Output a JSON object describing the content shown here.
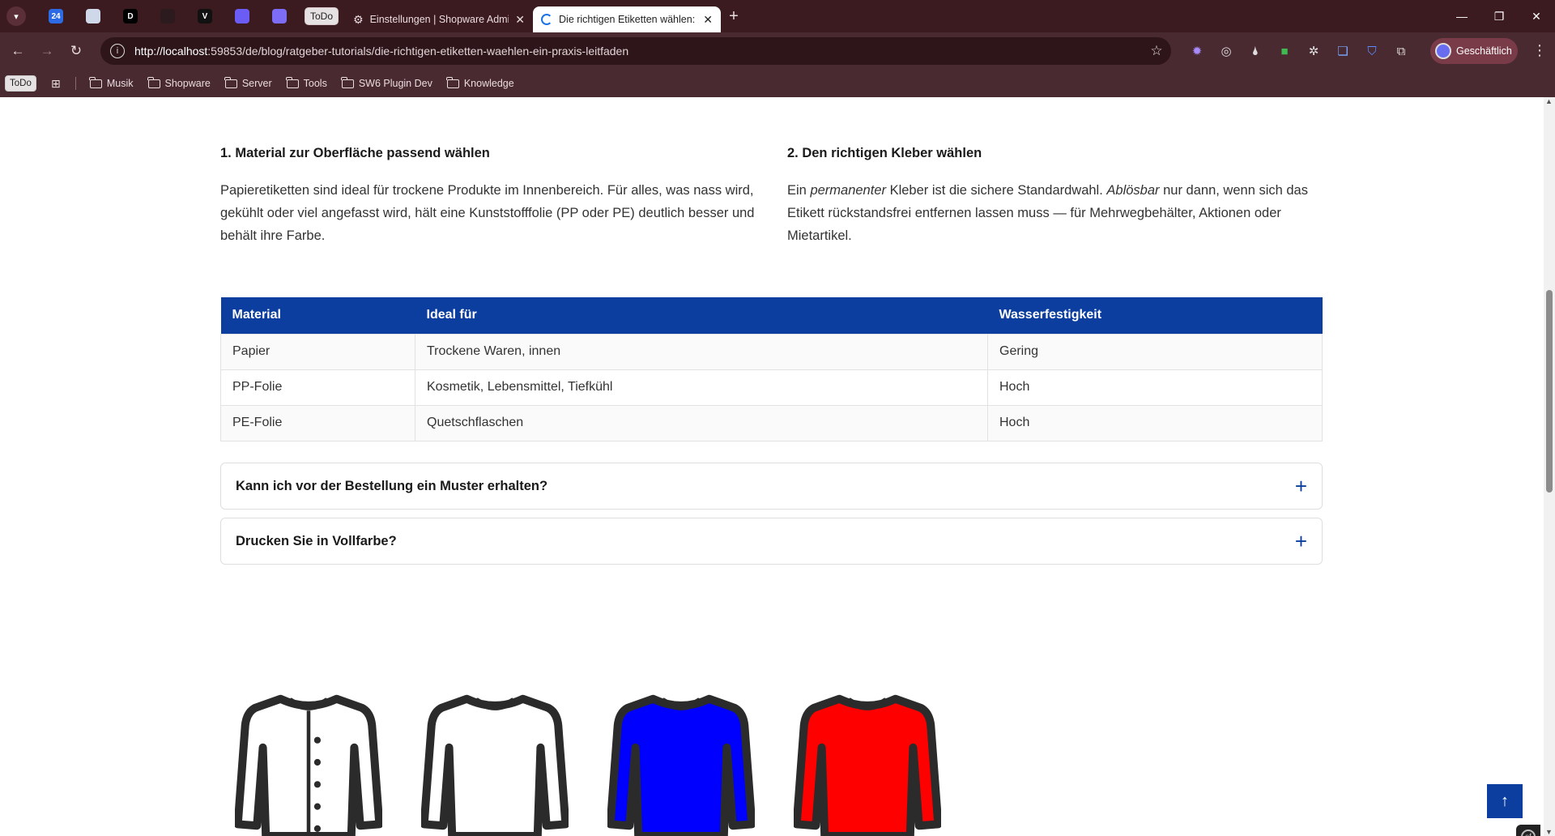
{
  "browser": {
    "pinned_tabs": [
      {
        "icon": "calendar-24-icon",
        "label": "24",
        "color": "#2d6be4"
      },
      {
        "icon": "cube-icon",
        "label": "",
        "color": "#cfd8e8"
      },
      {
        "icon": "d-logo-icon",
        "label": "D",
        "color": "#000000"
      },
      {
        "icon": "github-icon",
        "label": "",
        "color": "#2b1b1e"
      },
      {
        "icon": "v-logo-icon",
        "label": "V",
        "color": "#111111"
      },
      {
        "icon": "proton-icon",
        "label": "",
        "color": "#6b5cf5"
      },
      {
        "icon": "orb-icon",
        "label": "",
        "color": "#7d6cf6"
      }
    ],
    "todo_tab": "ToDo",
    "tabs": [
      {
        "title": "Einstellungen | Shopware Admin",
        "active": false
      },
      {
        "title": "Die richtigen Etiketten wählen: Ein Praxis-Leitfaden",
        "active": true
      }
    ],
    "url_host": "http://localhost",
    "url_rest": ":59853/de/blog/ratgeber-tutorials/die-richtigen-etiketten-waehlen-ein-praxis-leitfaden",
    "profile_label": "Geschäftlich",
    "bookmarks_todo": "ToDo",
    "bookmarks": [
      "Musik",
      "Shopware",
      "Server",
      "Tools",
      "SW6 Plugin Dev",
      "Knowledge"
    ]
  },
  "article": {
    "left": {
      "heading": "1. Material zur Oberfläche passend wählen",
      "text": "Papieretiketten sind ideal für trockene Produkte im Innenbereich. Für alles, was nass wird, gekühlt oder viel angefasst wird, hält eine Kunststofffolie (PP oder PE) deutlich besser und behält ihre Farbe."
    },
    "right": {
      "heading": "2. Den richtigen Kleber wählen",
      "text_1": "Ein ",
      "em_1": "permanenter",
      "text_2": " Kleber ist die sichere Standardwahl. ",
      "em_2": "Ablösbar",
      "text_3": " nur dann, wenn sich das Etikett rückstandsfrei entfernen lassen muss — für Mehrwegbehälter, Aktionen oder Mietartikel."
    },
    "table": {
      "headers": [
        "Material",
        "Ideal für",
        "Wasserfestigkeit"
      ],
      "rows": [
        [
          "Papier",
          "Trockene Waren, innen",
          "Gering"
        ],
        [
          "PP-Folie",
          "Kosmetik, Lebensmittel, Tiefkühl",
          "Hoch"
        ],
        [
          "PE-Folie",
          "Quetschflaschen",
          "Hoch"
        ]
      ]
    },
    "faq": [
      {
        "question": "Kann ich vor der Bestellung ein Muster erhalten?"
      },
      {
        "question": "Drucken Sie in Vollfarbe?"
      }
    ],
    "shirts": [
      {
        "icon": "shirt-icon",
        "fill": "#ffffff"
      },
      {
        "icon": "shirt-icon",
        "fill": "#ffffff"
      },
      {
        "icon": "shirt-icon",
        "fill": "#0000ff"
      },
      {
        "icon": "shirt-icon",
        "fill": "#ff0000"
      }
    ]
  },
  "colors": {
    "accent": "#0b3e9e",
    "chrome": "#4a2a31",
    "tabbar": "#3b1a20"
  }
}
